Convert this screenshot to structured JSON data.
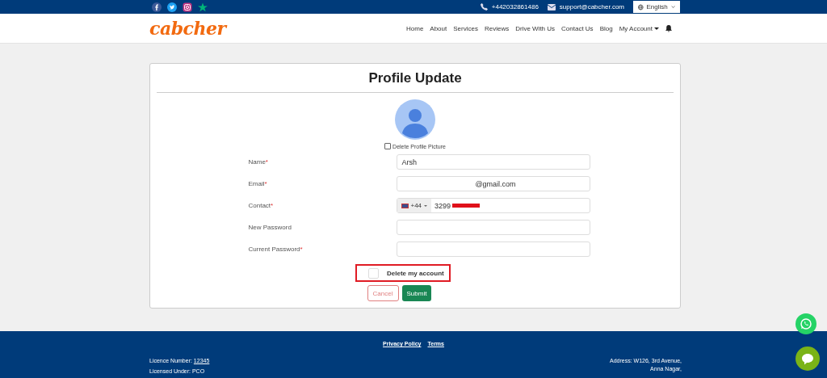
{
  "topbar": {
    "phone": "+442032861486",
    "email": "support@cabcher.com",
    "language": "English"
  },
  "header": {
    "logo": "cabcher",
    "nav": [
      {
        "label": "Home"
      },
      {
        "label": "About"
      },
      {
        "label": "Services"
      },
      {
        "label": "Reviews"
      },
      {
        "label": "Drive With Us"
      },
      {
        "label": "Contact Us"
      },
      {
        "label": "Blog"
      },
      {
        "label": "My Account",
        "dropdown": true
      }
    ]
  },
  "form": {
    "title": "Profile Update",
    "delete_picture": {
      "label": "Delete Profile Picture",
      "checked": false
    },
    "fields": [
      {
        "label": "Name",
        "required_mark": "*",
        "value": "Arsh",
        "kind": "text"
      },
      {
        "label": "Email",
        "required_mark": "*",
        "value": "@gmail.com",
        "kind": "redacted"
      },
      {
        "label": "Contact",
        "required_mark": "*",
        "value": "3299",
        "kind": "phone",
        "dial_code": "+44"
      },
      {
        "label": "New Password",
        "kind": "text"
      },
      {
        "label": "Current Password",
        "required_mark": "*",
        "kind": "text"
      }
    ],
    "delete_account": {
      "label": "Delete my account",
      "checked": false
    },
    "cancel": "Cancel",
    "submit": "Submit"
  },
  "footer": {
    "links": [
      "Privacy Policy",
      "Terms"
    ],
    "licence_label": "Licence Number:",
    "licence_number": "12345",
    "licensed_under": "Licensed Under: PCO",
    "address_lines": [
      "Address: W126, 3rd Avenue,",
      "Anna Nagar,"
    ]
  }
}
